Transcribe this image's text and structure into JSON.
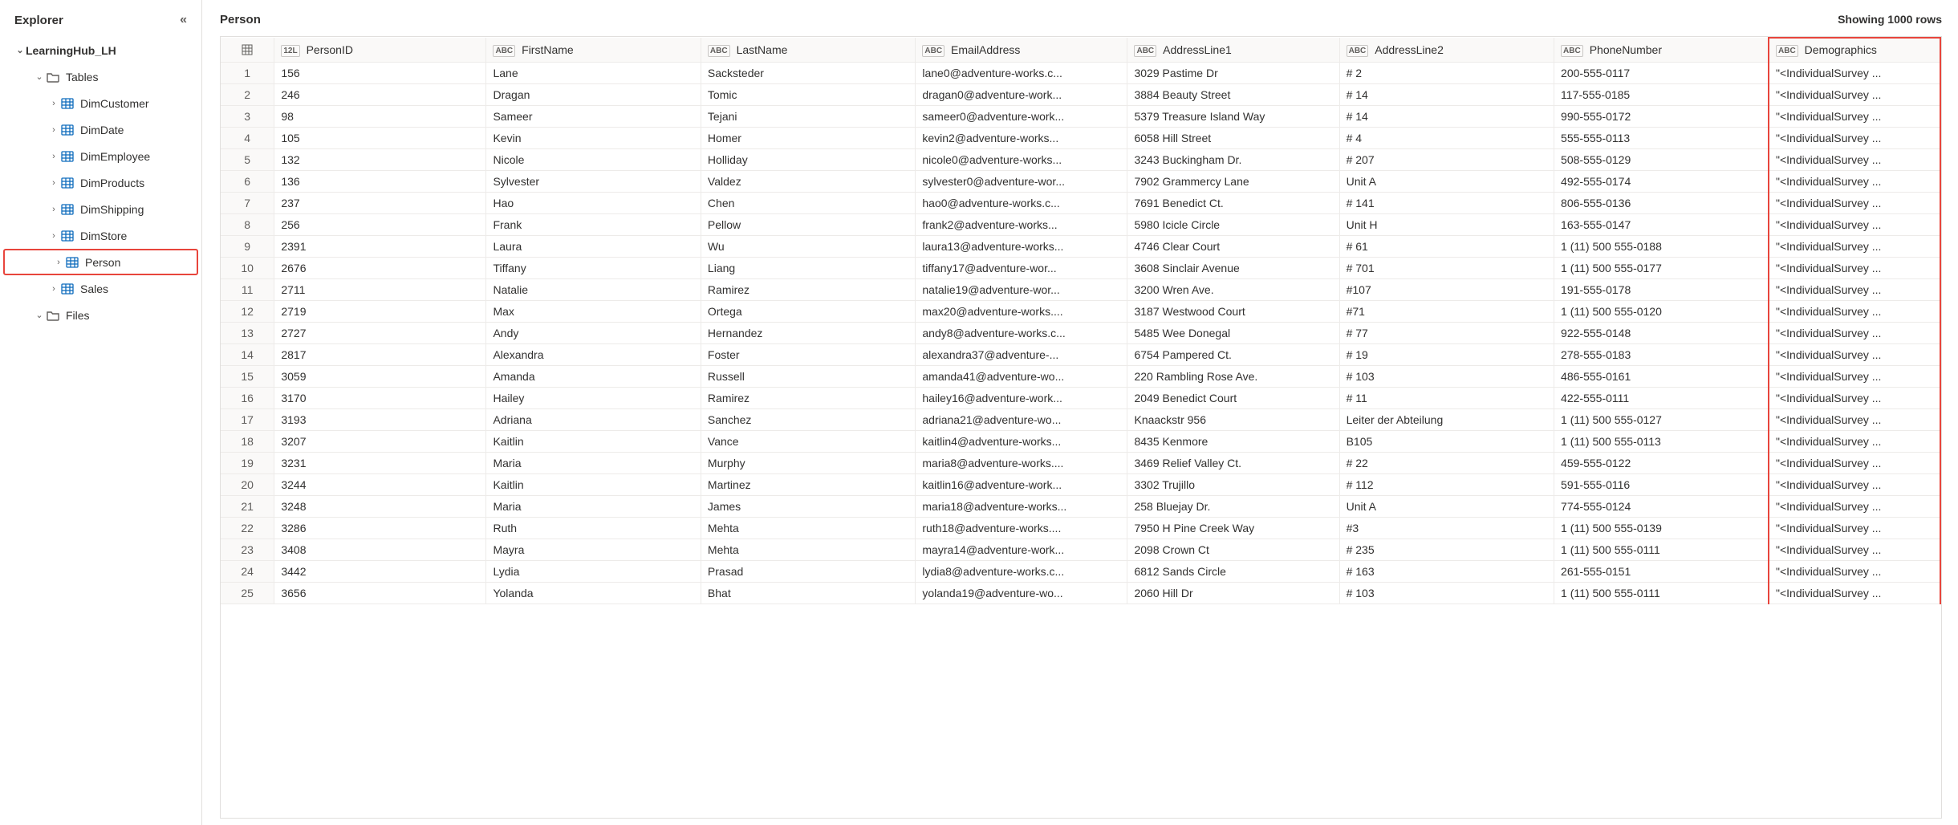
{
  "sidebar": {
    "title": "Explorer",
    "root": "LearningHub_LH",
    "tables_label": "Tables",
    "files_label": "Files",
    "tables": [
      "DimCustomer",
      "DimDate",
      "DimEmployee",
      "DimProducts",
      "DimShipping",
      "DimStore",
      "Person",
      "Sales"
    ],
    "selected_table": "Person"
  },
  "main": {
    "title": "Person",
    "row_count": "Showing 1000 rows"
  },
  "columns": [
    {
      "name": "PersonID",
      "type": "12L"
    },
    {
      "name": "FirstName",
      "type": "ABC"
    },
    {
      "name": "LastName",
      "type": "ABC"
    },
    {
      "name": "EmailAddress",
      "type": "ABC"
    },
    {
      "name": "AddressLine1",
      "type": "ABC"
    },
    {
      "name": "AddressLine2",
      "type": "ABC"
    },
    {
      "name": "PhoneNumber",
      "type": "ABC"
    },
    {
      "name": "Demographics",
      "type": "ABC"
    }
  ],
  "highlight_column": "Demographics",
  "rows": [
    {
      "n": 1,
      "PersonID": "156",
      "FirstName": "Lane",
      "LastName": "Sacksteder",
      "EmailAddress": "lane0@adventure-works.c...",
      "AddressLine1": "3029 Pastime Dr",
      "AddressLine2": "# 2",
      "PhoneNumber": "200-555-0117",
      "Demographics": "\"<IndividualSurvey ..."
    },
    {
      "n": 2,
      "PersonID": "246",
      "FirstName": "Dragan",
      "LastName": "Tomic",
      "EmailAddress": "dragan0@adventure-work...",
      "AddressLine1": "3884 Beauty Street",
      "AddressLine2": "# 14",
      "PhoneNumber": "117-555-0185",
      "Demographics": "\"<IndividualSurvey ..."
    },
    {
      "n": 3,
      "PersonID": "98",
      "FirstName": "Sameer",
      "LastName": "Tejani",
      "EmailAddress": "sameer0@adventure-work...",
      "AddressLine1": "5379 Treasure Island Way",
      "AddressLine2": "# 14",
      "PhoneNumber": "990-555-0172",
      "Demographics": "\"<IndividualSurvey ..."
    },
    {
      "n": 4,
      "PersonID": "105",
      "FirstName": "Kevin",
      "LastName": "Homer",
      "EmailAddress": "kevin2@adventure-works...",
      "AddressLine1": "6058 Hill Street",
      "AddressLine2": "# 4",
      "PhoneNumber": "555-555-0113",
      "Demographics": "\"<IndividualSurvey ..."
    },
    {
      "n": 5,
      "PersonID": "132",
      "FirstName": "Nicole",
      "LastName": "Holliday",
      "EmailAddress": "nicole0@adventure-works...",
      "AddressLine1": "3243 Buckingham Dr.",
      "AddressLine2": "# 207",
      "PhoneNumber": "508-555-0129",
      "Demographics": "\"<IndividualSurvey ..."
    },
    {
      "n": 6,
      "PersonID": "136",
      "FirstName": "Sylvester",
      "LastName": "Valdez",
      "EmailAddress": "sylvester0@adventure-wor...",
      "AddressLine1": "7902 Grammercy Lane",
      "AddressLine2": "Unit A",
      "PhoneNumber": "492-555-0174",
      "Demographics": "\"<IndividualSurvey ..."
    },
    {
      "n": 7,
      "PersonID": "237",
      "FirstName": "Hao",
      "LastName": "Chen",
      "EmailAddress": "hao0@adventure-works.c...",
      "AddressLine1": "7691 Benedict Ct.",
      "AddressLine2": "# 141",
      "PhoneNumber": "806-555-0136",
      "Demographics": "\"<IndividualSurvey ..."
    },
    {
      "n": 8,
      "PersonID": "256",
      "FirstName": "Frank",
      "LastName": "Pellow",
      "EmailAddress": "frank2@adventure-works...",
      "AddressLine1": "5980 Icicle Circle",
      "AddressLine2": "Unit H",
      "PhoneNumber": "163-555-0147",
      "Demographics": "\"<IndividualSurvey ..."
    },
    {
      "n": 9,
      "PersonID": "2391",
      "FirstName": "Laura",
      "LastName": "Wu",
      "EmailAddress": "laura13@adventure-works...",
      "AddressLine1": "4746 Clear Court",
      "AddressLine2": "# 61",
      "PhoneNumber": "1 (11) 500 555-0188",
      "Demographics": "\"<IndividualSurvey ..."
    },
    {
      "n": 10,
      "PersonID": "2676",
      "FirstName": "Tiffany",
      "LastName": "Liang",
      "EmailAddress": "tiffany17@adventure-wor...",
      "AddressLine1": "3608 Sinclair Avenue",
      "AddressLine2": "# 701",
      "PhoneNumber": "1 (11) 500 555-0177",
      "Demographics": "\"<IndividualSurvey ..."
    },
    {
      "n": 11,
      "PersonID": "2711",
      "FirstName": "Natalie",
      "LastName": "Ramirez",
      "EmailAddress": "natalie19@adventure-wor...",
      "AddressLine1": "3200 Wren Ave.",
      "AddressLine2": "#107",
      "PhoneNumber": "191-555-0178",
      "Demographics": "\"<IndividualSurvey ..."
    },
    {
      "n": 12,
      "PersonID": "2719",
      "FirstName": "Max",
      "LastName": "Ortega",
      "EmailAddress": "max20@adventure-works....",
      "AddressLine1": "3187 Westwood Court",
      "AddressLine2": "#71",
      "PhoneNumber": "1 (11) 500 555-0120",
      "Demographics": "\"<IndividualSurvey ..."
    },
    {
      "n": 13,
      "PersonID": "2727",
      "FirstName": "Andy",
      "LastName": "Hernandez",
      "EmailAddress": "andy8@adventure-works.c...",
      "AddressLine1": "5485 Wee Donegal",
      "AddressLine2": "# 77",
      "PhoneNumber": "922-555-0148",
      "Demographics": "\"<IndividualSurvey ..."
    },
    {
      "n": 14,
      "PersonID": "2817",
      "FirstName": "Alexandra",
      "LastName": "Foster",
      "EmailAddress": "alexandra37@adventure-...",
      "AddressLine1": "6754 Pampered Ct.",
      "AddressLine2": "# 19",
      "PhoneNumber": "278-555-0183",
      "Demographics": "\"<IndividualSurvey ..."
    },
    {
      "n": 15,
      "PersonID": "3059",
      "FirstName": "Amanda",
      "LastName": "Russell",
      "EmailAddress": "amanda41@adventure-wo...",
      "AddressLine1": "220 Rambling Rose Ave.",
      "AddressLine2": "# 103",
      "PhoneNumber": "486-555-0161",
      "Demographics": "\"<IndividualSurvey ..."
    },
    {
      "n": 16,
      "PersonID": "3170",
      "FirstName": "Hailey",
      "LastName": "Ramirez",
      "EmailAddress": "hailey16@adventure-work...",
      "AddressLine1": "2049 Benedict Court",
      "AddressLine2": "# 11",
      "PhoneNumber": "422-555-0111",
      "Demographics": "\"<IndividualSurvey ..."
    },
    {
      "n": 17,
      "PersonID": "3193",
      "FirstName": "Adriana",
      "LastName": "Sanchez",
      "EmailAddress": "adriana21@adventure-wo...",
      "AddressLine1": "Knaackstr 956",
      "AddressLine2": "Leiter der Abteilung",
      "PhoneNumber": "1 (11) 500 555-0127",
      "Demographics": "\"<IndividualSurvey ..."
    },
    {
      "n": 18,
      "PersonID": "3207",
      "FirstName": "Kaitlin",
      "LastName": "Vance",
      "EmailAddress": "kaitlin4@adventure-works...",
      "AddressLine1": "8435 Kenmore",
      "AddressLine2": "B105",
      "PhoneNumber": "1 (11) 500 555-0113",
      "Demographics": "\"<IndividualSurvey ..."
    },
    {
      "n": 19,
      "PersonID": "3231",
      "FirstName": "Maria",
      "LastName": "Murphy",
      "EmailAddress": "maria8@adventure-works....",
      "AddressLine1": "3469 Relief Valley Ct.",
      "AddressLine2": "# 22",
      "PhoneNumber": "459-555-0122",
      "Demographics": "\"<IndividualSurvey ..."
    },
    {
      "n": 20,
      "PersonID": "3244",
      "FirstName": "Kaitlin",
      "LastName": "Martinez",
      "EmailAddress": "kaitlin16@adventure-work...",
      "AddressLine1": "3302 Trujillo",
      "AddressLine2": "# 112",
      "PhoneNumber": "591-555-0116",
      "Demographics": "\"<IndividualSurvey ..."
    },
    {
      "n": 21,
      "PersonID": "3248",
      "FirstName": "Maria",
      "LastName": "James",
      "EmailAddress": "maria18@adventure-works...",
      "AddressLine1": "258 Bluejay Dr.",
      "AddressLine2": "Unit A",
      "PhoneNumber": "774-555-0124",
      "Demographics": "\"<IndividualSurvey ..."
    },
    {
      "n": 22,
      "PersonID": "3286",
      "FirstName": "Ruth",
      "LastName": "Mehta",
      "EmailAddress": "ruth18@adventure-works....",
      "AddressLine1": "7950 H Pine Creek Way",
      "AddressLine2": "#3",
      "PhoneNumber": "1 (11) 500 555-0139",
      "Demographics": "\"<IndividualSurvey ..."
    },
    {
      "n": 23,
      "PersonID": "3408",
      "FirstName": "Mayra",
      "LastName": "Mehta",
      "EmailAddress": "mayra14@adventure-work...",
      "AddressLine1": "2098 Crown Ct",
      "AddressLine2": "# 235",
      "PhoneNumber": "1 (11) 500 555-0111",
      "Demographics": "\"<IndividualSurvey ..."
    },
    {
      "n": 24,
      "PersonID": "3442",
      "FirstName": "Lydia",
      "LastName": "Prasad",
      "EmailAddress": "lydia8@adventure-works.c...",
      "AddressLine1": "6812 Sands Circle",
      "AddressLine2": "# 163",
      "PhoneNumber": "261-555-0151",
      "Demographics": "\"<IndividualSurvey ..."
    },
    {
      "n": 25,
      "PersonID": "3656",
      "FirstName": "Yolanda",
      "LastName": "Bhat",
      "EmailAddress": "yolanda19@adventure-wo...",
      "AddressLine1": "2060 Hill Dr",
      "AddressLine2": "# 103",
      "PhoneNumber": "1 (11) 500 555-0111",
      "Demographics": "\"<IndividualSurvey ..."
    }
  ]
}
